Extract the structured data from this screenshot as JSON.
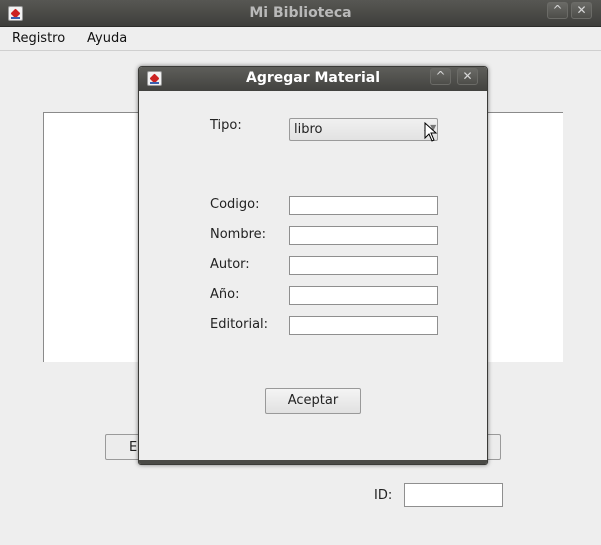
{
  "main_window": {
    "title": "Mi Biblioteca",
    "menu": [
      {
        "label": "Registro"
      },
      {
        "label": "Ayuda"
      }
    ],
    "background_button_label": "E",
    "id_label": "ID:",
    "id_value": ""
  },
  "dialog": {
    "title": "Agregar Material",
    "tipo_label": "Tipo:",
    "tipo_value": "libro",
    "fields": [
      {
        "label": "Codigo:",
        "value": ""
      },
      {
        "label": "Nombre:",
        "value": ""
      },
      {
        "label": "Autor:",
        "value": ""
      },
      {
        "label": "Año:",
        "value": ""
      },
      {
        "label": "Editorial:",
        "value": ""
      }
    ],
    "accept_label": "Aceptar"
  },
  "icons": {
    "minimize": "^",
    "close": "✕",
    "combo_arrow": "▲▼"
  }
}
